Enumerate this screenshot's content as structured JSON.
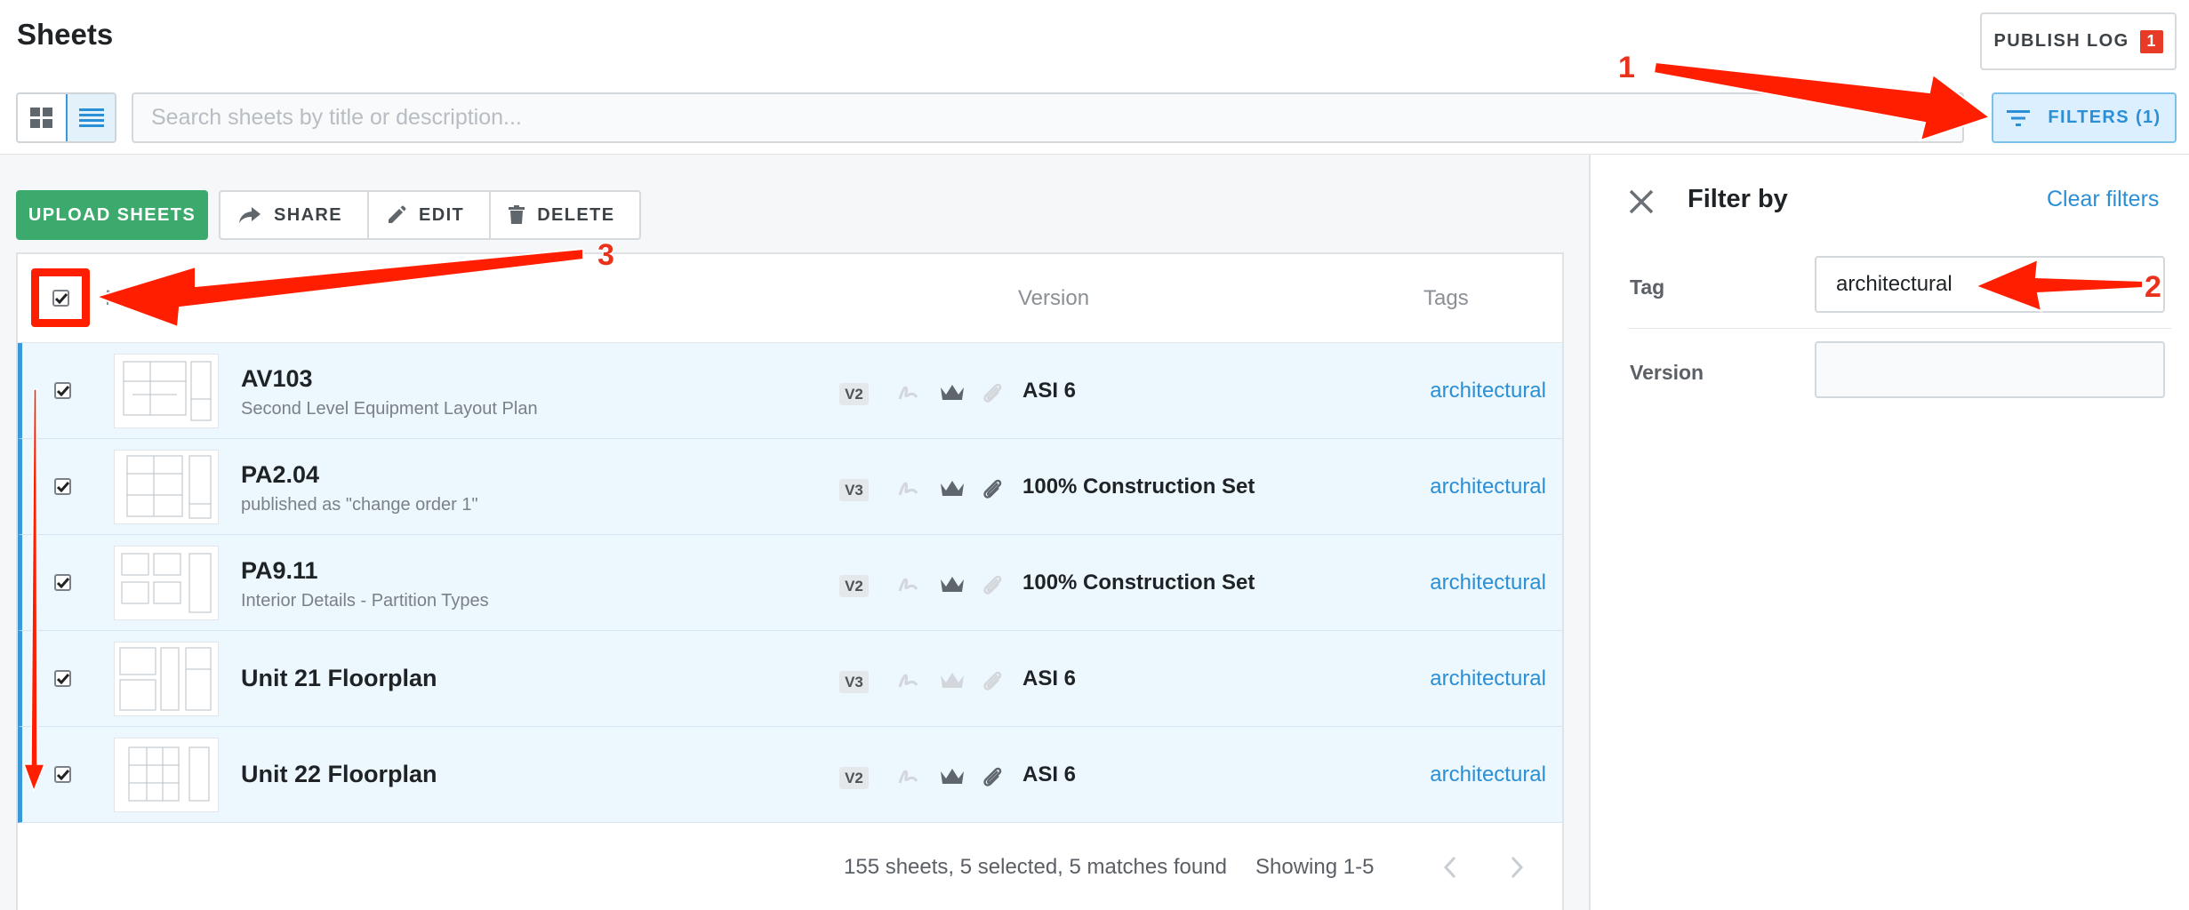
{
  "header": {
    "title": "Sheets",
    "publish_log_label": "PUBLISH LOG",
    "publish_log_count": "1",
    "search_placeholder": "Search sheets by title or description...",
    "filters_label": "FILTERS (1)"
  },
  "toolbar": {
    "upload_label": "UPLOAD SHEETS",
    "share_label": "SHARE",
    "edit_label": "EDIT",
    "delete_label": "DELETE"
  },
  "table": {
    "columns": {
      "name": "Name",
      "version": "Version",
      "tags": "Tags"
    },
    "rows": [
      {
        "title": "AV103",
        "subtitle": "Second Level Equipment Layout Plan",
        "version_badge": "V2",
        "version": "ASI 6",
        "tag": "architectural"
      },
      {
        "title": "PA2.04",
        "subtitle": "published as \"change order 1\"",
        "version_badge": "V3",
        "version": "100% Construction Set",
        "tag": "architectural"
      },
      {
        "title": "PA9.11",
        "subtitle": "Interior Details - Partition Types",
        "version_badge": "V2",
        "version": "100% Construction Set",
        "tag": "architectural"
      },
      {
        "title": "Unit 21 Floorplan",
        "subtitle": "",
        "version_badge": "V3",
        "version": "ASI 6",
        "tag": "architectural"
      },
      {
        "title": "Unit 22 Floorplan",
        "subtitle": "",
        "version_badge": "V2",
        "version": "ASI 6",
        "tag": "architectural"
      }
    ],
    "footer": {
      "count_text": "155 sheets, 5 selected, 5 matches found",
      "showing_text": "Showing 1-5"
    }
  },
  "filter_panel": {
    "title": "Filter by",
    "clear_label": "Clear filters",
    "tag_label": "Tag",
    "tag_value": "architectural",
    "version_label": "Version",
    "version_value": ""
  },
  "annotations": {
    "one": "1",
    "two": "2",
    "three": "3"
  },
  "colors": {
    "accent": "#2b8fd6",
    "upload_green": "#3daa6d",
    "badge_red": "#e83b27",
    "annotation_red": "#ff1e00",
    "selected_row": "#edf7fe"
  },
  "icons": [
    "grid-view-icon",
    "list-view-icon",
    "filter-lines-icon",
    "share-arrow-icon",
    "pencil-icon",
    "trash-icon",
    "markup-icon",
    "crown-icon",
    "paperclip-icon",
    "close-icon",
    "chevron-left-icon",
    "chevron-right-icon"
  ]
}
